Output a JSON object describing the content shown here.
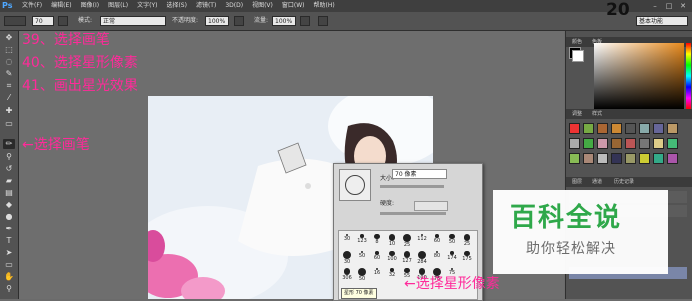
{
  "app": {
    "logo": "Ps"
  },
  "menu": [
    "文件(F)",
    "编辑(E)",
    "图像(I)",
    "图层(L)",
    "文字(Y)",
    "选择(S)",
    "滤镜(T)",
    "3D(D)",
    "视图(V)",
    "窗口(W)",
    "帮助(H)"
  ],
  "options_bar": {
    "brush_size": "70",
    "mode_label": "模式:",
    "mode_value": "正常",
    "opacity_label": "不透明度:",
    "opacity_value": "100%",
    "flow_label": "流量:",
    "flow_value": "100%",
    "workspace": "基本功能"
  },
  "step_number": "20",
  "annotations": {
    "step39": "39、选择画笔",
    "step40": "40、选择星形像素",
    "step41": "41、画出星光效果",
    "select_brush": "←选择画笔",
    "select_star": "←选择星形像素"
  },
  "brush_panel": {
    "size_label": "大小:",
    "size_value": "70 像素",
    "hardness_label": "硬度:",
    "tooltip": "星形 70 像素",
    "presets": [
      "30",
      "123",
      "8",
      "10",
      "25",
      "112",
      "60",
      "50",
      "25",
      "30",
      "50",
      "60",
      "100",
      "127",
      "284",
      "80",
      "174",
      "175",
      "306",
      "50",
      "16",
      "32",
      "55",
      "100",
      "75",
      "75"
    ]
  },
  "right_dock": {
    "color_tabs": [
      "颜色",
      "色板"
    ],
    "style_tabs": [
      "调整",
      "样式"
    ],
    "layer_tabs": [
      "图层",
      "通道",
      "历史记录"
    ]
  },
  "watermark": {
    "title": "百科全说",
    "subtitle": "助你轻松解决"
  },
  "colors": {
    "annotation": "#ff2a9a",
    "watermark_green": "#2fa84a"
  }
}
